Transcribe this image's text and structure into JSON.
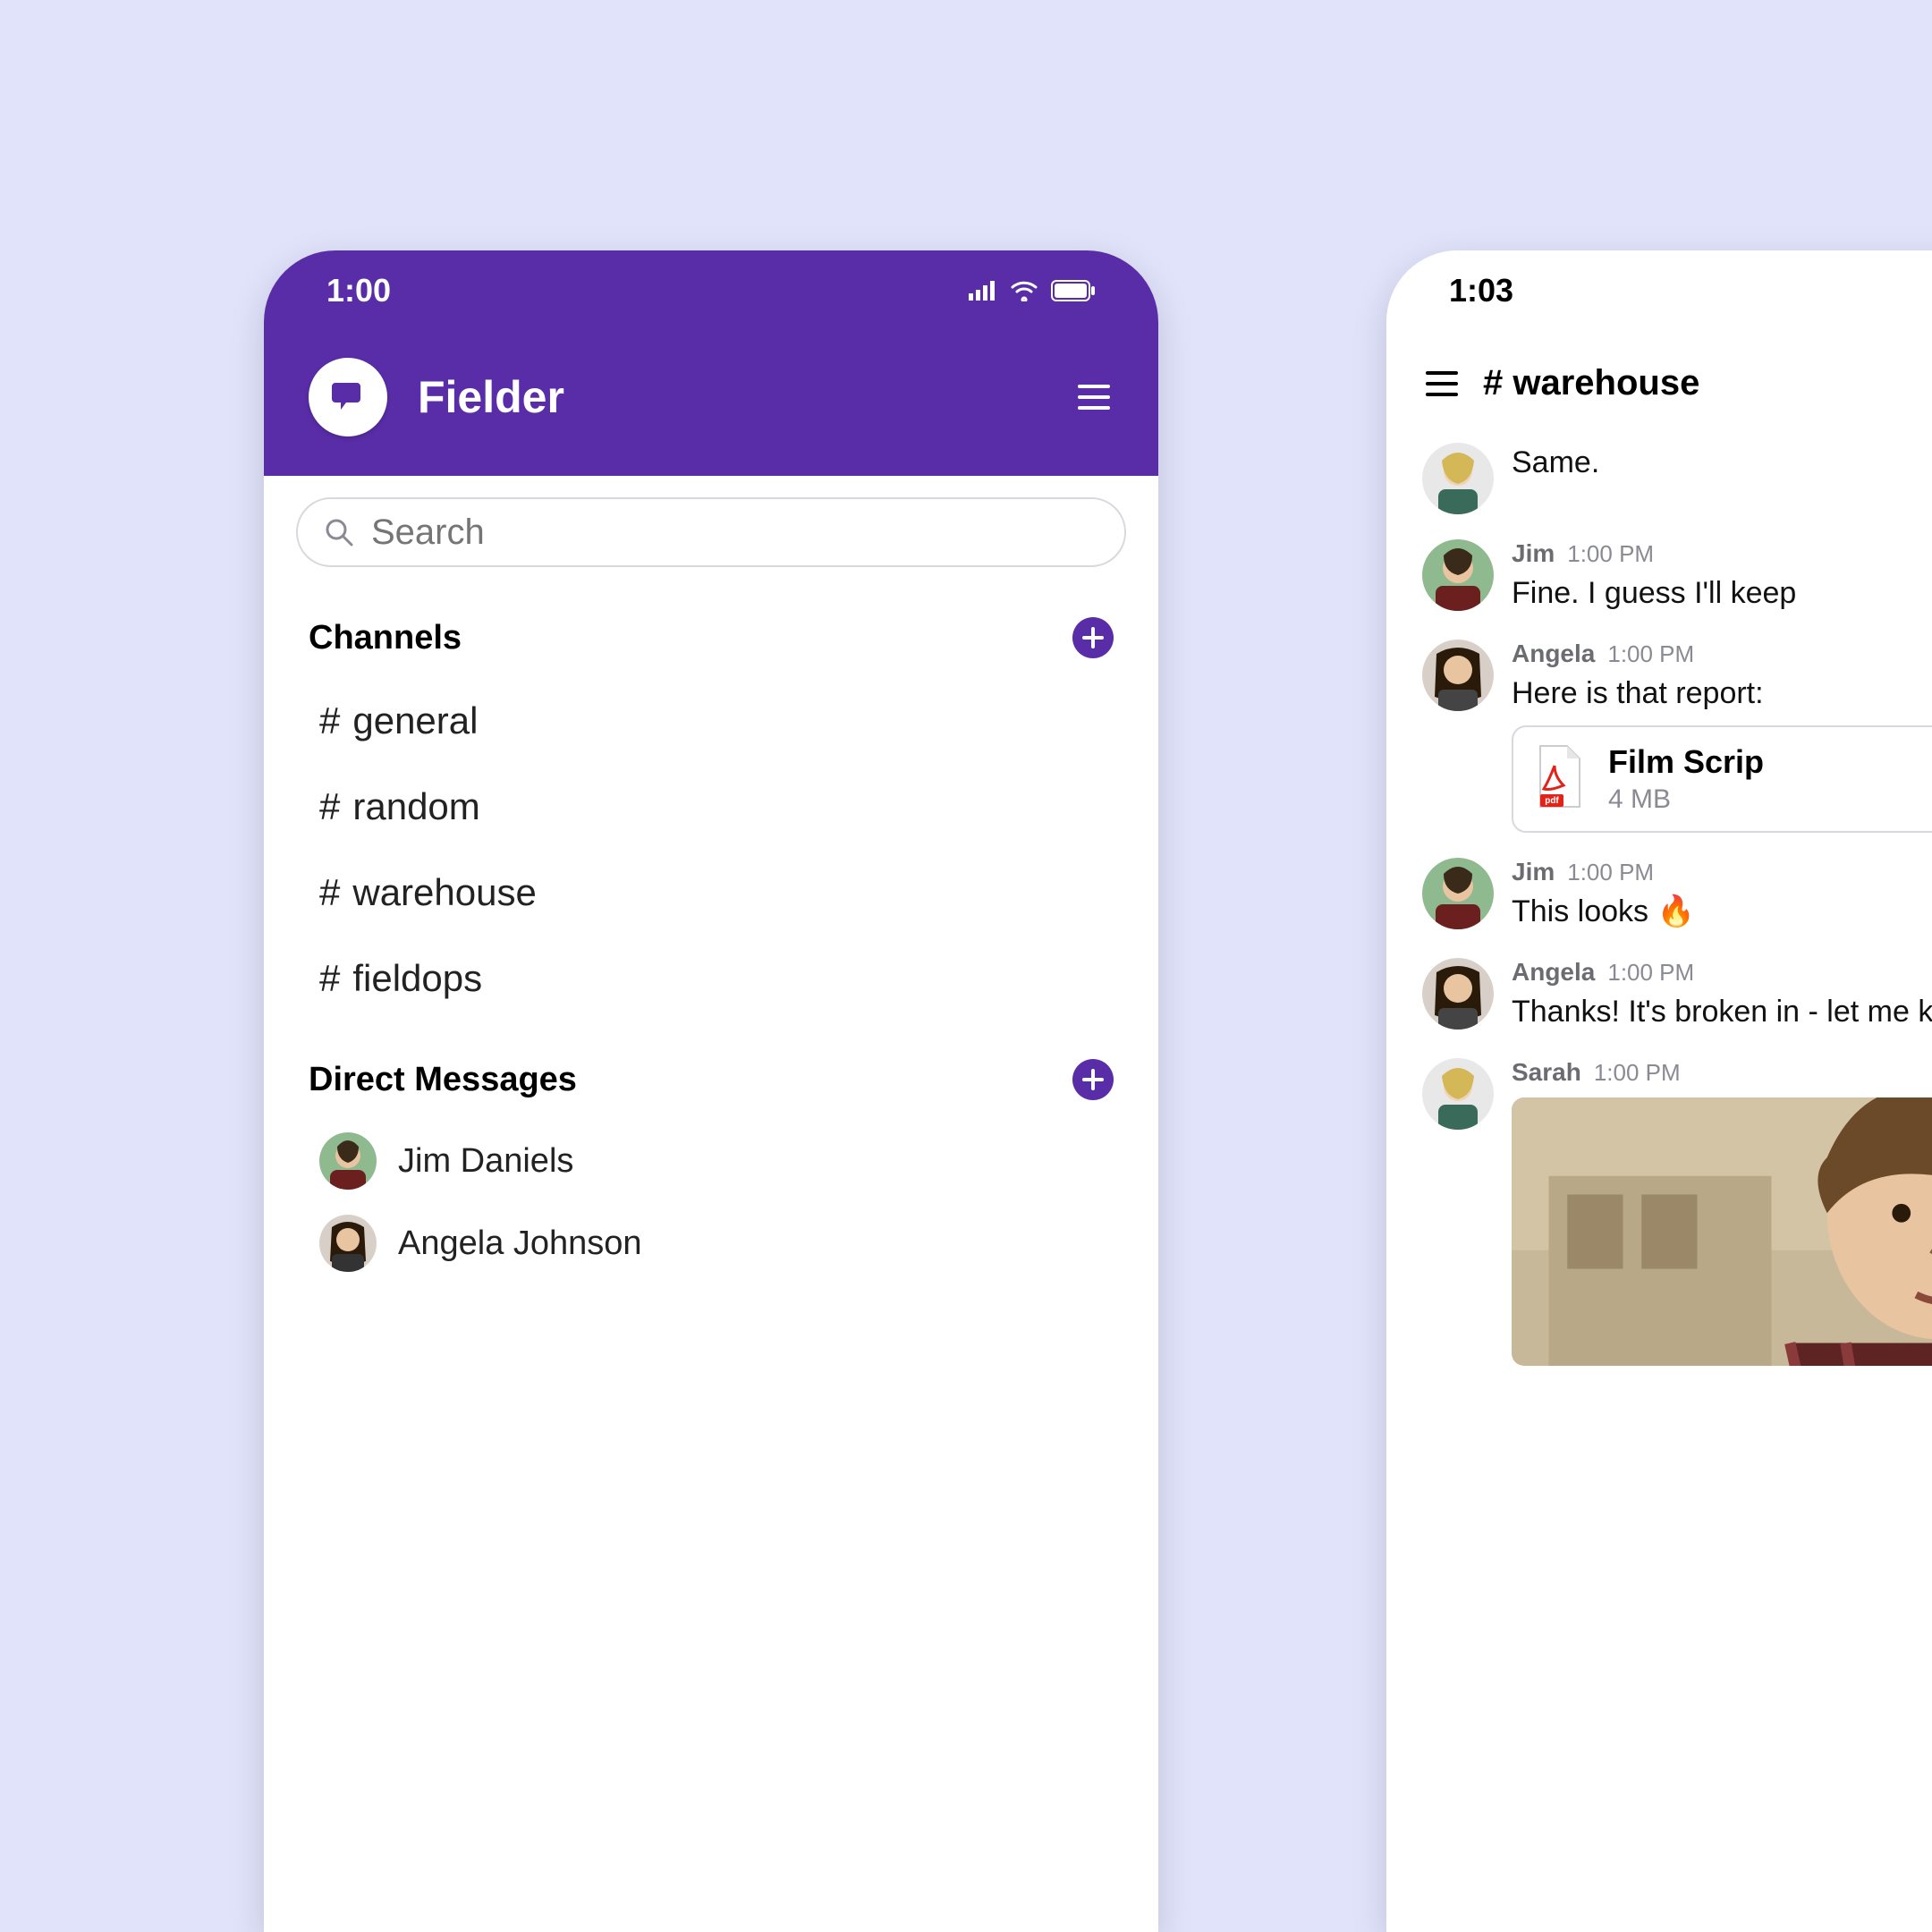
{
  "left": {
    "status_time": "1:00",
    "app_title": "Fielder",
    "search_placeholder": "Search",
    "channels_header": "Channels",
    "channels": [
      {
        "name": "general"
      },
      {
        "name": "random"
      },
      {
        "name": "warehouse"
      },
      {
        "name": "fieldops"
      }
    ],
    "dms_header": "Direct Messages",
    "dms": [
      {
        "name": "Jim Daniels"
      },
      {
        "name": "Angela Johnson"
      }
    ]
  },
  "right": {
    "status_time": "1:03",
    "channel_label": "# warehouse",
    "messages": [
      {
        "author": "",
        "time": "",
        "text": "Same."
      },
      {
        "author": "Jim",
        "time": "1:00 PM",
        "text": "Fine. I guess I'll keep"
      },
      {
        "author": "Angela",
        "time": "1:00 PM",
        "text": "Here is that report:",
        "file": {
          "name": "Film Scrip",
          "size": "4 MB"
        }
      },
      {
        "author": "Jim",
        "time": "1:00 PM",
        "text": "This looks 🔥"
      },
      {
        "author": "Angela",
        "time": "1:00 PM",
        "text": "Thanks! It's broken in - let me know of any "
      },
      {
        "author": "Sarah",
        "time": "1:00 PM",
        "text": "",
        "has_gif": true
      }
    ]
  }
}
